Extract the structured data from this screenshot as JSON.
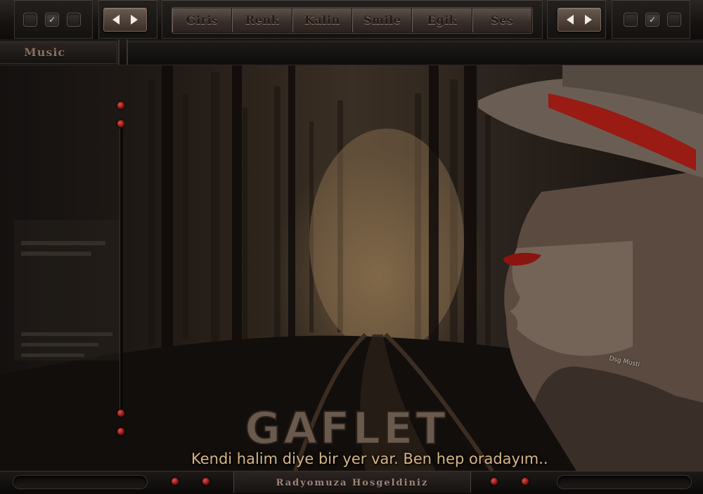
{
  "top": {
    "left_checks": [
      false,
      true,
      false
    ],
    "right_checks": [
      false,
      true,
      false
    ],
    "menu": [
      "Giris",
      "Renk",
      "Kalin",
      "Smile",
      "Egik",
      "Ses"
    ]
  },
  "sidebar": {
    "tab_label": "Music"
  },
  "banner": {
    "logo_text": "GAFLET",
    "tagline": "Kendi halim diye bir yer var. Ben hep oradayım..",
    "signature": "Dsg Musti"
  },
  "footer": {
    "welcome": "Radyomuza Hosgeldiniz"
  },
  "colors": {
    "accent_red": "#b01a14",
    "button_brown": "#4a3c35",
    "tagline": "#d8b585"
  },
  "icons": {
    "check": "✓",
    "prev": "prev-arrow-icon",
    "next": "next-arrow-icon"
  }
}
